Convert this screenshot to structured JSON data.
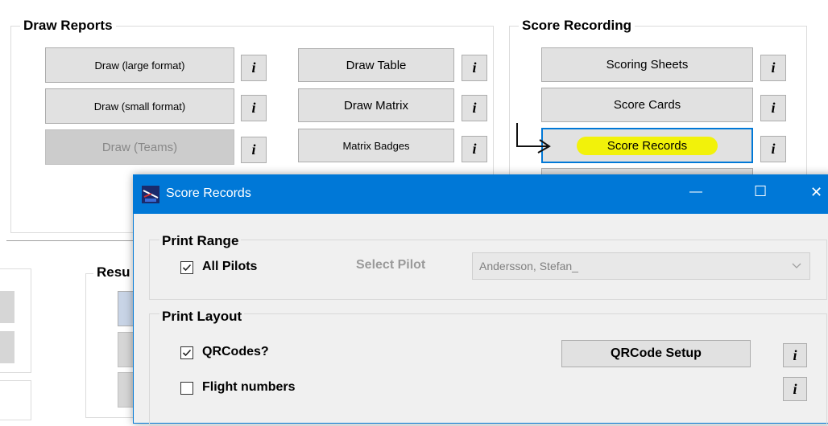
{
  "draw_reports": {
    "title": "Draw Reports",
    "buttons": {
      "draw_large": "Draw (large format)",
      "draw_small": "Draw (small format)",
      "draw_teams": "Draw (Teams)",
      "draw_table": "Draw Table",
      "draw_matrix": "Draw Matrix",
      "matrix_badges": "Matrix Badges"
    }
  },
  "score_recording": {
    "title": "Score Recording",
    "buttons": {
      "scoring_sheets": "Scoring Sheets",
      "score_cards": "Score Cards",
      "score_records": "Score Records"
    }
  },
  "results_group": {
    "title_partial": "Resu"
  },
  "info_label": "i",
  "dialog": {
    "title": "Score Records",
    "controls": {
      "minimize": "—",
      "maximize": "☐",
      "close": "✕"
    },
    "print_range": {
      "title": "Print Range",
      "all_pilots_label": "All Pilots",
      "all_pilots_checked": true,
      "select_pilot_label": "Select Pilot",
      "pilot_value": "Andersson, Stefan_"
    },
    "print_layout": {
      "title": "Print Layout",
      "qrcodes_label": "QRCodes?",
      "qrcodes_checked": true,
      "qrcode_setup_label": "QRCode Setup",
      "flight_numbers_label": "Flight numbers",
      "flight_numbers_checked": false
    }
  },
  "colors": {
    "title_bar": "#0078d7",
    "highlight": "#f2f20a",
    "button_face": "#e1e1e1"
  }
}
